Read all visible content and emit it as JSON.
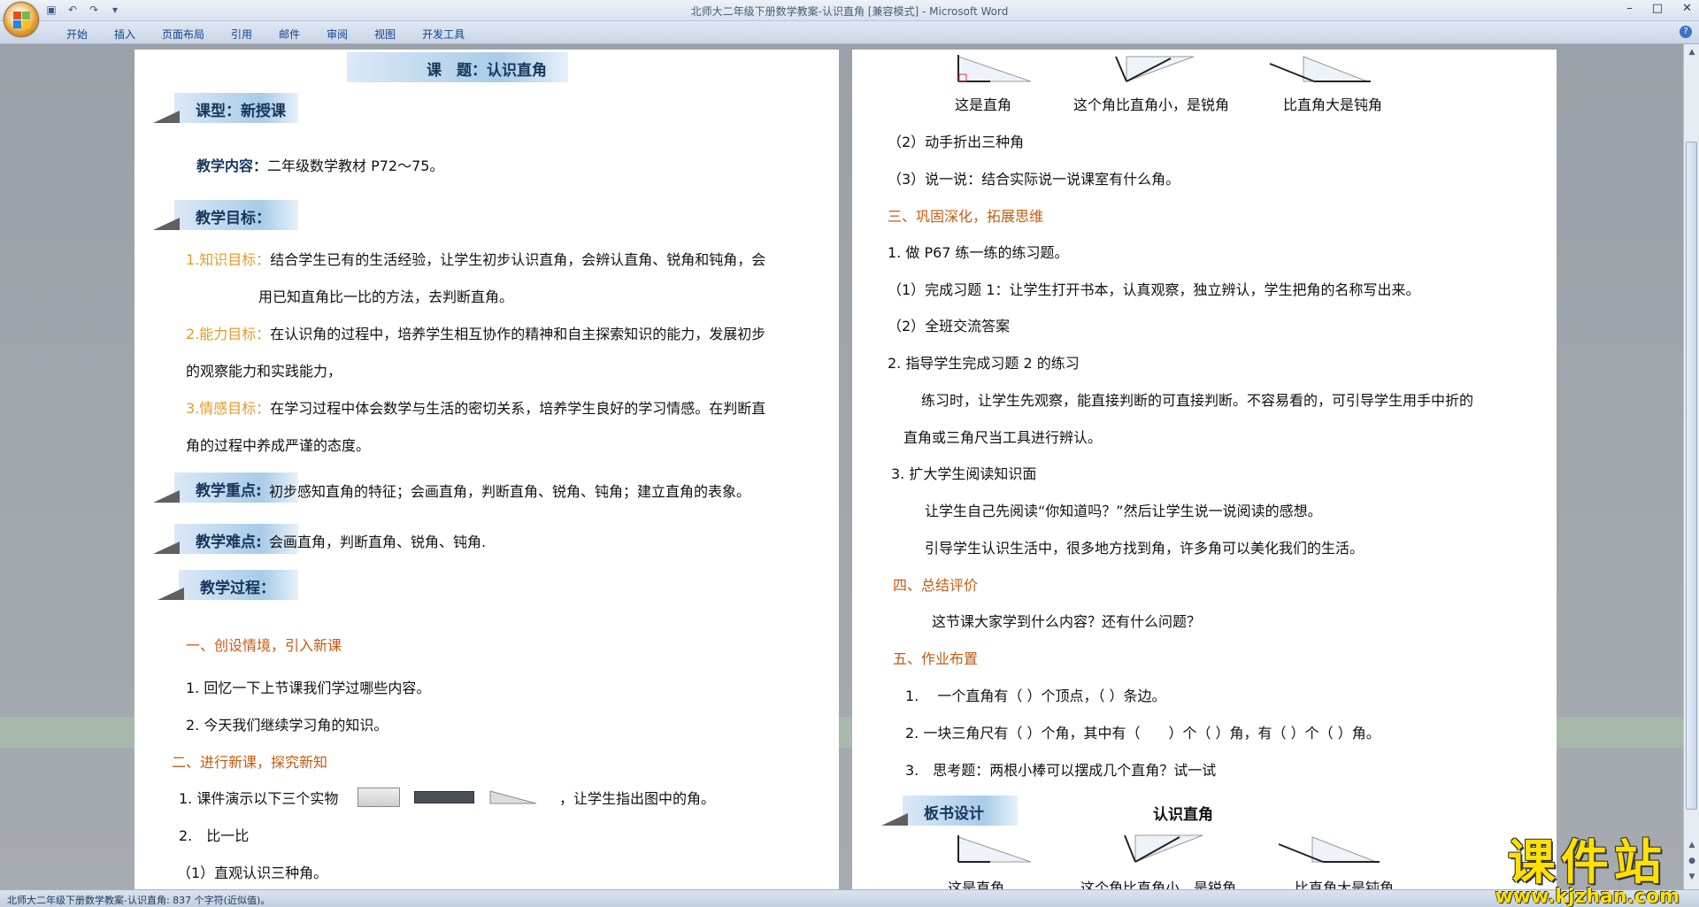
{
  "window": {
    "title": "北师大二年级下册数学教案-认识直角 [兼容模式] - Microsoft Word",
    "controls": [
      "–",
      "□",
      "✕"
    ]
  },
  "ribbon": {
    "tabs": [
      "开始",
      "插入",
      "页面布局",
      "引用",
      "邮件",
      "审阅",
      "视图",
      "开发工具"
    ]
  },
  "left_page": {
    "topic": "课　题：认识直角",
    "lesson_type": "课型：新授课",
    "content_label": "教学内容：",
    "content_text": "二年级数学教材 P72～75。",
    "goals_heading": "教学目标：",
    "goal1_label": "1.知识目标：",
    "goal1_line1": "结合学生已有的生活经验，让学生初步认识直角，会辨认直角、锐角和钝角，会",
    "goal1_line2": "用已知直角比一比的方法，去判断直角。",
    "goal2_label": "2.能力目标：",
    "goal2_line1": "在认识角的过程中，培养学生相互协作的精神和自主探索知识的能力，发展初步",
    "goal2_line2": "的观察能力和实践能力，",
    "goal3_label": "3.情感目标：",
    "goal3_line1": "在学习过程中体会数学与生活的密切关系，培养学生良好的学习情感。在判断直",
    "goal3_line2": "角的过程中养成严谨的态度。",
    "key_heading": "教学重点:",
    "key_text": "初步感知直角的特征；会画直角，判断直角、锐角、钝角；建立直角的表象。",
    "difficulty_heading": "教学难点:",
    "difficulty_text": "会画直角，判断直角、锐角、钝角.",
    "process_heading": "教学过程：",
    "step1_title": "一、创设情境，引入新课",
    "step1_item1": "1. 回忆一下上节课我们学过哪些内容。",
    "step1_item2": "2. 今天我们继续学习角的知识。",
    "step2_title": "二、进行新课，探究新知",
    "step2_item1_a": "1. 课件演示以下三个实物",
    "step2_item1_b": "，让学生指出图中的角。",
    "step2_item2": "2.　比一比",
    "step2_item3": "（1）直观认识三种角。"
  },
  "right_page": {
    "fig_caption1": "这是直角",
    "fig_caption2": "这个角比直角小，是锐角",
    "fig_caption3": "比直角大是钝角",
    "line_fold": "（2）动手折出三种角",
    "line_say": "（3）说一说：结合实际说一说课室有什么角。",
    "sec3_title": "三、巩固深化，拓展思维",
    "sec3_item1": "1. 做 P67 练一练的练习题。",
    "sec3_item1a": "（1）完成习题 1：让学生打开书本，认真观察，独立辨认，学生把角的名称写出来。",
    "sec3_item1b": "（2）全班交流答案",
    "sec3_item2": "2. 指导学生完成习题 2 的练习",
    "sec3_item2_l1": "练习时，让学生先观察，能直接判断的可直接判断。不容易看的，可引导学生用手中折的",
    "sec3_item2_l2": "直角或三角尺当工具进行辨认。",
    "sec3_item3": "3. 扩大学生阅读知识面",
    "sec3_item3_l1": "让学生自己先阅读“你知道吗？”然后让学生说一说阅读的感想。",
    "sec3_item3_l2": "引导学生认识生活中，很多地方找到角，许多角可以美化我们的生活。",
    "sec4_title": "四、总结评价",
    "sec4_text": "这节课大家学到什么内容？还有什么问题？",
    "sec5_title": "五、作业布置",
    "hw1": "1.　 一个直角有（ ）个顶点，（ ）条边。",
    "hw2": "2. 一块三角尺有（ ）个角，其中有（　　）个（ ）角，有（ ）个（ ）角。",
    "hw3": "3.　思考题：两根小棒可以摆成几个直角？试一试",
    "board_heading": "板书设计",
    "board_title": "认识直角",
    "board_caption1": "这是直角",
    "board_caption2": "这个角比直角小，是锐角",
    "board_caption3": "比直角大是钝角"
  },
  "status_bar": {
    "text": "北师大二年级下册数学教案-认识直角: 837 个字符(近似值)。"
  },
  "watermark": {
    "big": "课件站",
    "small": "www.kjzhan.com"
  },
  "icons": [
    "office-button-icon",
    "save-icon",
    "undo-icon",
    "redo-icon",
    "help-icon"
  ],
  "colors": {
    "orange_label": "#e59a2b",
    "section_title": "#c55a11",
    "heading_text": "#17365d"
  }
}
